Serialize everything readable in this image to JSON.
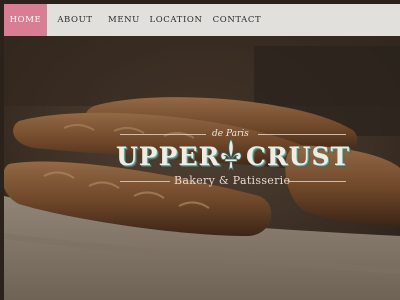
{
  "nav": {
    "items": [
      {
        "label": "HOME",
        "active": true
      },
      {
        "label": "ABOUT"
      },
      {
        "label": "MENU"
      },
      {
        "label": "LOCATION"
      },
      {
        "label": "CONTACT"
      }
    ]
  },
  "hero": {
    "logo": {
      "tagline_top": "de Paris",
      "word_left": "UPPER",
      "word_right": "CRUST",
      "subtitle": "Bakery & Patisserie",
      "emblem_icon": "fleur-de-lis-icon"
    }
  },
  "colors": {
    "nav_bg": "#e2e0dd",
    "active_tab": "#d97d95",
    "logo_shadow": "#6fa79d"
  }
}
